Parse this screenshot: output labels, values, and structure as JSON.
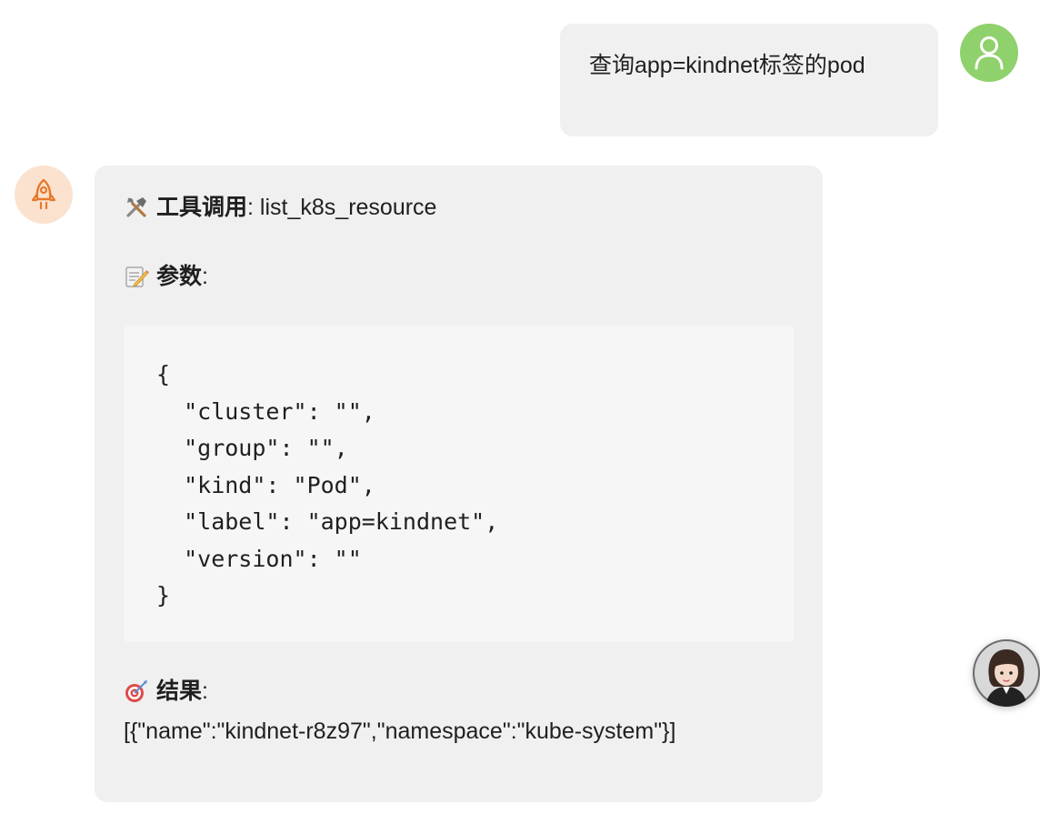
{
  "user_message": {
    "text": "查询app=kindnet标签的pod"
  },
  "assistant_message": {
    "tool_call": {
      "label": "工具调用",
      "separator": ":",
      "name": "list_k8s_resource"
    },
    "params": {
      "label": "参数",
      "separator": ":",
      "code": "{\n  \"cluster\": \"\",\n  \"group\": \"\",\n  \"kind\": \"Pod\",\n  \"label\": \"app=kindnet\",\n  \"version\": \"\"\n}"
    },
    "result": {
      "label": "结果",
      "separator": ":",
      "value": "[{\"name\":\"kindnet-r8z97\",\"namespace\":\"kube-system\"}]"
    }
  },
  "icons": {
    "user_avatar": "user-icon",
    "bot_avatar": "rocket-icon",
    "tool": "tools-icon",
    "params": "memo-icon",
    "result": "target-icon",
    "floating": "assistant-avatar-icon"
  },
  "colors": {
    "user_avatar_bg": "#8fd16c",
    "bot_avatar_bg": "#fbe2cf",
    "bot_icon": "#e8782a",
    "bubble_bg": "#f0f0f0",
    "code_bg": "#f6f6f6"
  }
}
